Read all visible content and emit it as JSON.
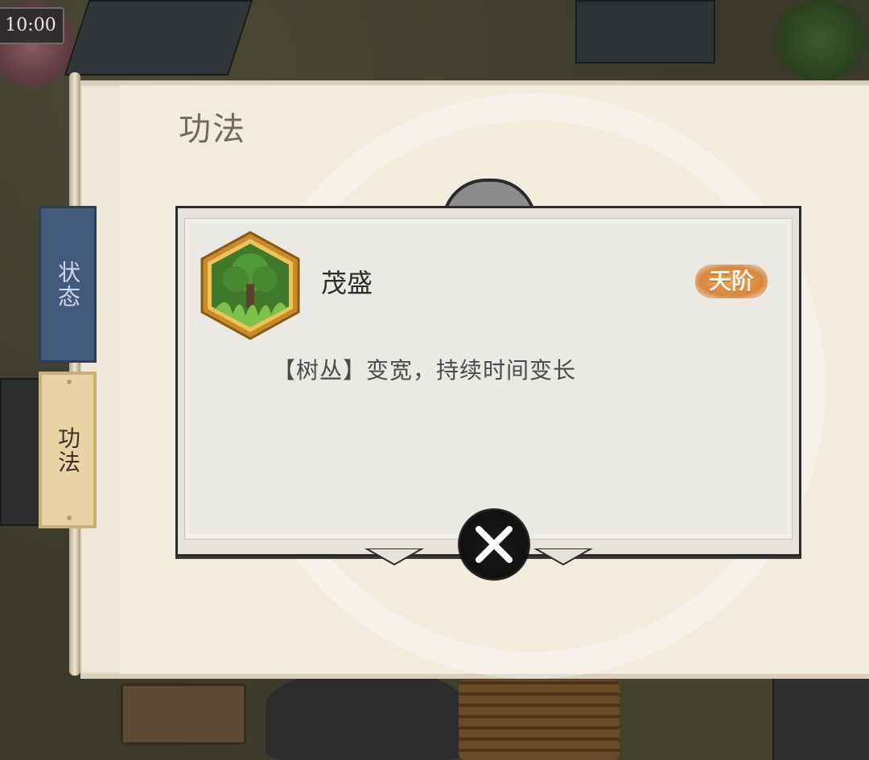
{
  "hud": {
    "clock": "10:00"
  },
  "panel": {
    "title": "功法"
  },
  "tabs": [
    {
      "label": "状态",
      "active": false
    },
    {
      "label": "功法",
      "active": true
    }
  ],
  "skill": {
    "name": "茂盛",
    "rank": "天阶",
    "description": "【树丛】变宽，持续时间变长",
    "icon": "tree-icon"
  },
  "colors": {
    "status_tab": "#435a7a",
    "active_tab": "#e8d3a3",
    "rank_badge": "#d9873c",
    "panel_bg": "#efe8da"
  }
}
